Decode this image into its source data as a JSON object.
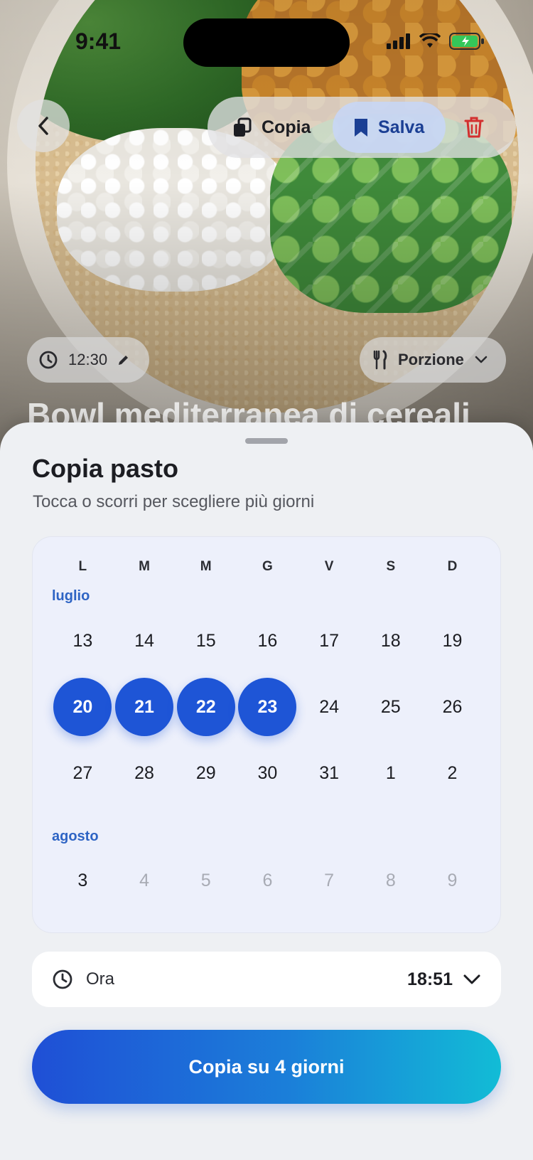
{
  "status_bar": {
    "time": "9:41"
  },
  "header": {
    "copy_label": "Copia",
    "save_label": "Salva"
  },
  "hero": {
    "meal_time": "12:30",
    "portion_label": "Porzione",
    "title": "Bowl mediterranea di cereali"
  },
  "sheet": {
    "title": "Copia pasto",
    "subtitle": "Tocca o scorri per scegliere più giorni",
    "weekdays": [
      "L",
      "M",
      "M",
      "G",
      "V",
      "S",
      "D"
    ],
    "months": [
      {
        "label": "luglio",
        "weeks": [
          [
            "13",
            "14",
            "15",
            "16",
            "17",
            "18",
            "19"
          ],
          [
            "20",
            "21",
            "22",
            "23",
            "24",
            "25",
            "26"
          ],
          [
            "27",
            "28",
            "29",
            "30",
            "31",
            "1",
            "2"
          ]
        ]
      },
      {
        "label": "agosto",
        "weeks": [
          [
            "3",
            "4",
            "5",
            "6",
            "7",
            "8",
            "9"
          ]
        ]
      }
    ],
    "selected_days": [
      "20",
      "21",
      "22",
      "23"
    ],
    "time_label": "Ora",
    "time_value": "18:51",
    "cta_label": "Copia su 4 giorni"
  },
  "icons": {
    "back": "chevron-left-icon",
    "copy": "copy-icon",
    "save": "bookmark-icon",
    "delete": "trash-icon",
    "clock": "clock-icon",
    "edit": "pencil-icon",
    "portion": "fork-knife-icon",
    "dropdown": "chevron-down-icon"
  },
  "colors": {
    "accent": "#1e55d6",
    "save_text": "#1b3f94",
    "delete": "#d32f2f",
    "month_label": "#2e64c4",
    "muted_day": "#a8abb4"
  }
}
